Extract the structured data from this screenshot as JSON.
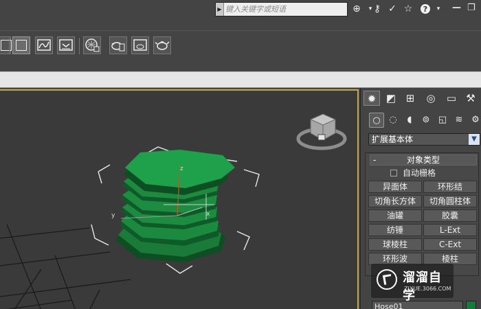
{
  "search": {
    "placeholder": "键入关键字或短语"
  },
  "top_icons": [
    "binoculars-icon",
    "key-icon",
    "star-icon",
    "help-icon"
  ],
  "window_controls": [
    "minimize-icon",
    "restore-icon"
  ],
  "toolbar": {
    "icons": [
      "folder-icon",
      "graph-editor-icon",
      "schematic-icon",
      "material-editor-icon",
      "render-setup-icon",
      "render-frame-icon",
      "render-teapot-icon"
    ]
  },
  "command_panel": {
    "tabs": [
      "create-tab",
      "modify-tab",
      "hierarchy-tab",
      "motion-tab",
      "display-tab",
      "utilities-tab"
    ],
    "subtabs": [
      "geometry",
      "shapes",
      "lights",
      "cameras",
      "helpers",
      "space-warps",
      "systems"
    ],
    "category": "扩展基本体",
    "rollout_title": "对象类型",
    "rollout_collapse": "-",
    "autogrid_label": "自动栅格",
    "object_buttons": [
      [
        "异面体",
        "环形结"
      ],
      [
        "切角长方体",
        "切角圆柱体"
      ],
      [
        "油罐",
        "胶囊"
      ],
      [
        "纺锤",
        "L-Ext"
      ],
      [
        "球棱柱",
        "C-Ext"
      ],
      [
        "环形波",
        "棱柱"
      ]
    ],
    "object_name": "Hose01",
    "object_color": "#127c3a"
  },
  "viewport": {
    "object_color": "#1e8a3e",
    "axis_labels": [
      "x",
      "y",
      "z"
    ],
    "border_color": "#c9a94a"
  },
  "watermark": {
    "title": "溜溜自学",
    "url": "ZIXUE.3066.COM"
  }
}
